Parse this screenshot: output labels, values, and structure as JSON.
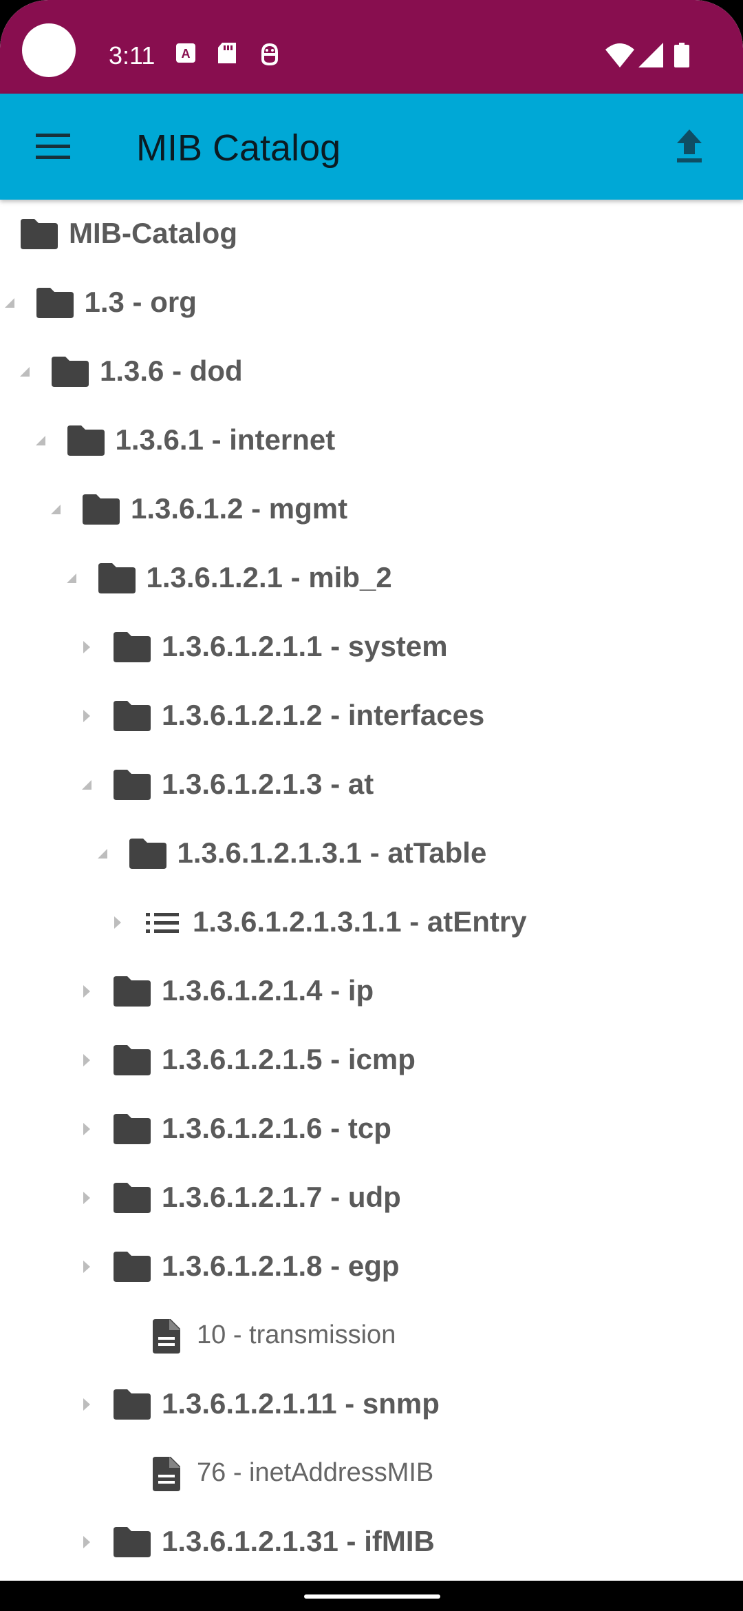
{
  "status_bar": {
    "time": "3:11",
    "left_icons": [
      "text-format-icon",
      "sd-card-icon",
      "android-debug-icon"
    ],
    "right_icons": [
      "wifi-icon",
      "cell-signal-icon",
      "battery-icon"
    ]
  },
  "app_bar": {
    "title": "MIB Catalog",
    "menu_icon": "hamburger-menu-icon",
    "action_icon": "upload-icon"
  },
  "tree": {
    "items": [
      {
        "label": "MIB-Catalog",
        "icon": "folder-icon",
        "arrow": "none"
      },
      {
        "label": "1.3 - org",
        "icon": "folder-icon",
        "arrow": "expanded"
      },
      {
        "label": "1.3.6 - dod",
        "icon": "folder-icon",
        "arrow": "expanded"
      },
      {
        "label": "1.3.6.1 - internet",
        "icon": "folder-icon",
        "arrow": "expanded"
      },
      {
        "label": "1.3.6.1.2 - mgmt",
        "icon": "folder-icon",
        "arrow": "expanded"
      },
      {
        "label": "1.3.6.1.2.1 - mib_2",
        "icon": "folder-icon",
        "arrow": "expanded"
      },
      {
        "label": "1.3.6.1.2.1.1 - system",
        "icon": "folder-icon",
        "arrow": "collapsed"
      },
      {
        "label": "1.3.6.1.2.1.2 - interfaces",
        "icon": "folder-icon",
        "arrow": "collapsed"
      },
      {
        "label": "1.3.6.1.2.1.3 - at",
        "icon": "folder-icon",
        "arrow": "expanded"
      },
      {
        "label": "1.3.6.1.2.1.3.1 - atTable",
        "icon": "folder-icon",
        "arrow": "expanded"
      },
      {
        "label": "1.3.6.1.2.1.3.1.1 - atEntry",
        "icon": "list-icon",
        "arrow": "collapsed"
      },
      {
        "label": "1.3.6.1.2.1.4 - ip",
        "icon": "folder-icon",
        "arrow": "collapsed"
      },
      {
        "label": "1.3.6.1.2.1.5 - icmp",
        "icon": "folder-icon",
        "arrow": "collapsed"
      },
      {
        "label": "1.3.6.1.2.1.6 - tcp",
        "icon": "folder-icon",
        "arrow": "collapsed"
      },
      {
        "label": "1.3.6.1.2.1.7 - udp",
        "icon": "folder-icon",
        "arrow": "collapsed"
      },
      {
        "label": "1.3.6.1.2.1.8 - egp",
        "icon": "folder-icon",
        "arrow": "collapsed"
      },
      {
        "label": "10 - transmission",
        "icon": "document-icon",
        "arrow": "none"
      },
      {
        "label": "1.3.6.1.2.1.11 - snmp",
        "icon": "folder-icon",
        "arrow": "collapsed"
      },
      {
        "label": "76 - inetAddressMIB",
        "icon": "document-icon",
        "arrow": "none"
      },
      {
        "label": "1.3.6.1.2.1.31 - ifMIB",
        "icon": "folder-icon",
        "arrow": "collapsed"
      }
    ]
  }
}
